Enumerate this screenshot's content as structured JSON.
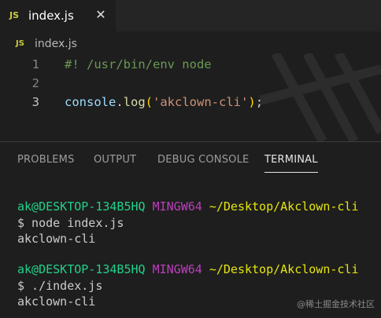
{
  "tab": {
    "icon": "JS",
    "label": "index.js",
    "close": "✕"
  },
  "breadcrumb": {
    "icon": "JS",
    "label": "index.js"
  },
  "editor": {
    "lines": [
      {
        "number": "1",
        "comment": "#! /usr/bin/env node"
      },
      {
        "number": "2"
      },
      {
        "number": "3",
        "object": "console",
        "dot": ".",
        "method": "log",
        "open": "(",
        "string": "'akclown-cli'",
        "close": ")",
        "semi": ";"
      }
    ]
  },
  "panel": {
    "tabs": [
      "PROBLEMS",
      "OUTPUT",
      "DEBUG CONSOLE",
      "TERMINAL"
    ],
    "active_tab": "TERMINAL"
  },
  "terminal": {
    "sessions": [
      {
        "user": "ak@DESKTOP-134B5HQ",
        "system": "MINGW64",
        "path": "~/Desktop/Akclown-cli",
        "command": "$ node index.js",
        "output": "akclown-cli"
      },
      {
        "user": "ak@DESKTOP-134B5HQ",
        "system": "MINGW64",
        "path": "~/Desktop/Akclown-cli",
        "command": "$ ./index.js",
        "output": "akclown-cli"
      }
    ]
  },
  "credit": "@稀土掘金技术社区",
  "colors": {
    "background": "#1e1e1e",
    "tabbar": "#252526",
    "js_icon": "#cbcb41",
    "comment": "#6a9955",
    "string": "#ce9178",
    "terminal_user": "#23d18b",
    "terminal_system": "#bc3fbc",
    "terminal_path": "#e5e510"
  }
}
